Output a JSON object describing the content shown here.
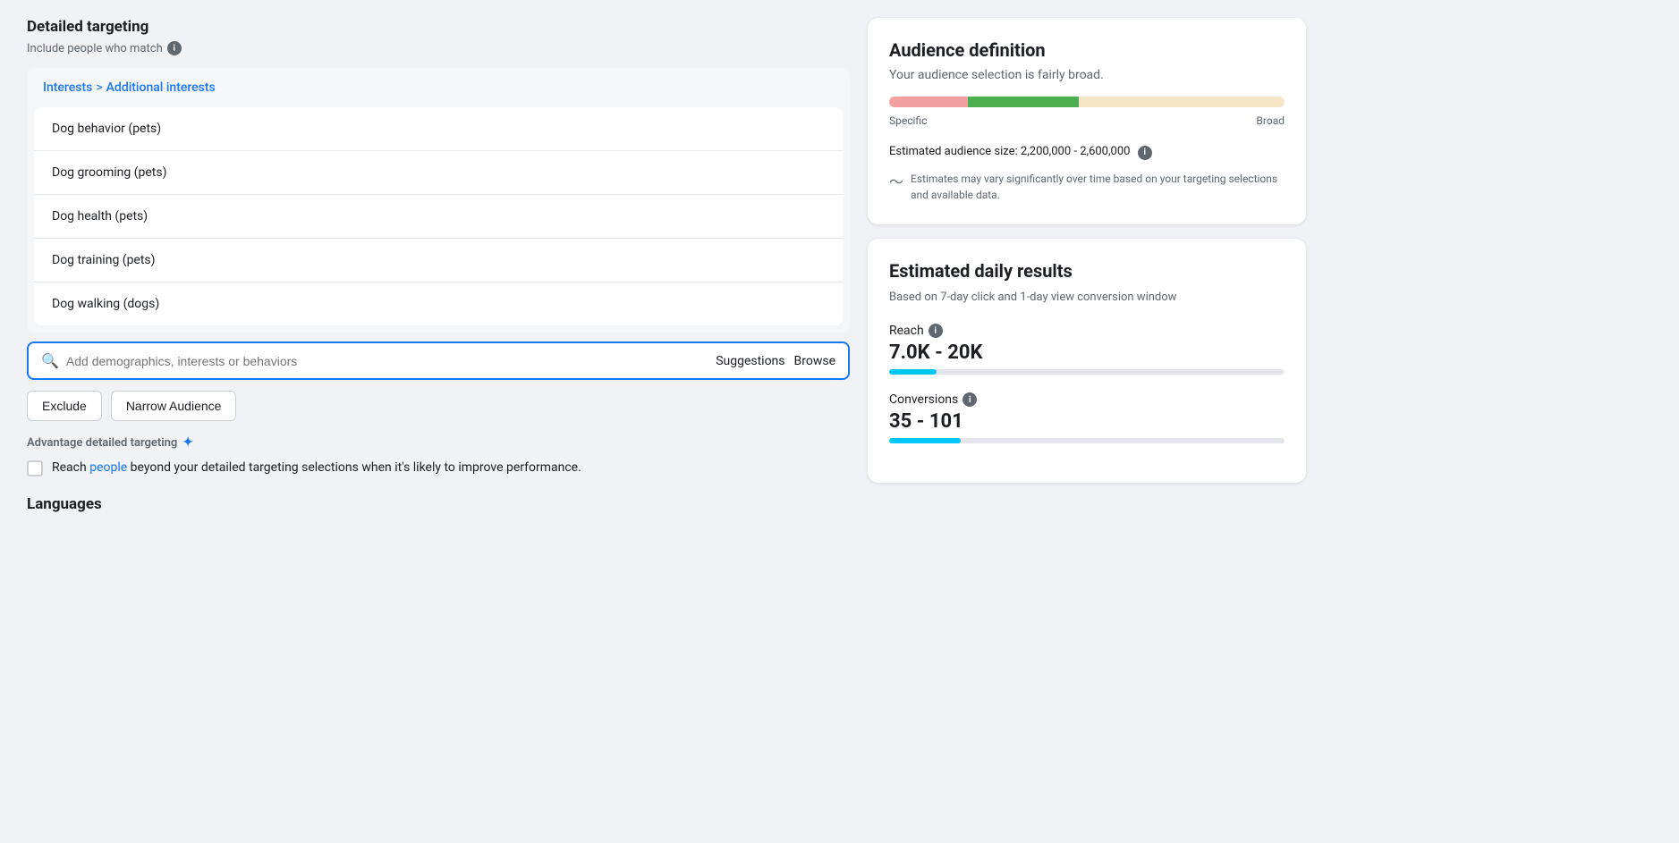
{
  "left": {
    "section_title": "Detailed targeting",
    "include_label": "Include people who match",
    "breadcrumb": {
      "part1": "Interests",
      "separator": ">",
      "part2": "Additional interests"
    },
    "interest_items": [
      "Dog behavior (pets)",
      "Dog grooming (pets)",
      "Dog health (pets)",
      "Dog training (pets)",
      "Dog walking (dogs)"
    ],
    "search_placeholder": "Add demographics, interests or behaviors",
    "search_action1": "Suggestions",
    "search_action2": "Browse",
    "btn_exclude": "Exclude",
    "btn_narrow": "Narrow Audience",
    "advantage_title": "Advantage detailed targeting",
    "advantage_text_pre": "Reach ",
    "advantage_link": "people",
    "advantage_text_post": " beyond your detailed targeting selections when it's likely to improve performance.",
    "languages_title": "Languages"
  },
  "right": {
    "audience_card": {
      "title": "Audience definition",
      "subtitle": "Your audience selection is fairly broad.",
      "meter_label_left": "Specific",
      "meter_label_right": "Broad",
      "audience_size_label": "Estimated audience size: 2,200,000 - 2,600,000",
      "estimate_note": "Estimates may vary significantly over time based on your targeting selections and available data."
    },
    "daily_results_card": {
      "title": "Estimated daily results",
      "subtitle": "Based on 7-day click and 1-day view conversion window",
      "reach_label": "Reach",
      "reach_value": "7.0K - 20K",
      "reach_bar_width": "12%",
      "conversions_label": "Conversions",
      "conversions_value": "35 - 101",
      "conversions_bar_width": "18%"
    }
  }
}
